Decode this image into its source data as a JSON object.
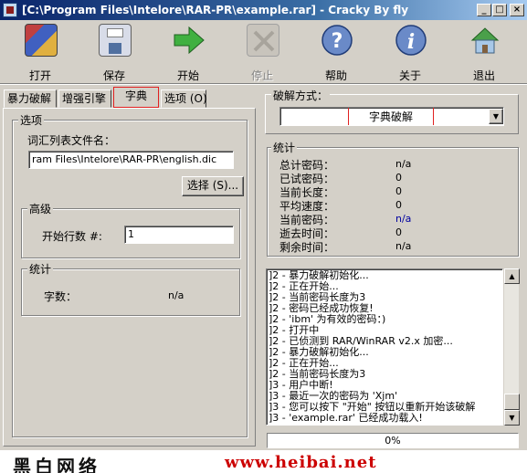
{
  "window": {
    "title": "[C:\\Program Files\\Intelore\\RAR-PR\\example.rar] - Cracky By fly",
    "min": "_",
    "max": "□",
    "close": "×"
  },
  "toolbar": {
    "open": "打开",
    "save": "保存",
    "start": "开始",
    "stop": "停止",
    "help": "帮助",
    "about": "关于",
    "exit": "退出"
  },
  "tabs": [
    "暴力破解",
    "增强引擎",
    "字典",
    "选项 (O)"
  ],
  "options": {
    "group_label": "选项",
    "wordlist_label": "词汇列表文件名：",
    "wordlist_value": "ram Files\\Intelore\\RAR-PR\\english.dic",
    "select_button": "选择 (S)...",
    "advanced_label": "高级",
    "start_line_label": "开始行数 #:",
    "start_line_value": "1",
    "stats_label": "统计",
    "word_count_label": "字数：",
    "word_count_value": "n/a"
  },
  "crack_method": {
    "label": "破解方式：",
    "selected": "字典破解"
  },
  "stats": {
    "label": "统计",
    "rows": [
      {
        "label": "总计密码：",
        "value": "n/a"
      },
      {
        "label": "已试密码：",
        "value": "0"
      },
      {
        "label": "当前长度：",
        "value": "0"
      },
      {
        "label": "平均速度：",
        "value": "0"
      },
      {
        "label": "当前密码：",
        "value": "n/a"
      },
      {
        "label": "逝去时间：",
        "value": "0"
      },
      {
        "label": "剩余时间：",
        "value": "n/a"
      }
    ]
  },
  "log": [
    "]2 - 暴力破解初始化...",
    "]2 - 正在开始...",
    "]2 - 当前密码长度为3",
    "]2 - 密码已经成功恢复!",
    "]2 - 'ibm' 为有效的密码：)",
    "]2 - 打开中",
    "]2 - 已侦测到 RAR/WinRAR v2.x 加密...",
    "]2 - 暴力破解初始化...",
    "]2 - 正在开始...",
    "]2 - 当前密码长度为3",
    "]3 - 用户中断!",
    "]3 - 最近一次的密码为 'Xjm'",
    "]3 - 您可以按下 \"开始\" 按钮以重新开始该破解",
    "]3 - 'example.rar' 已经成功载入!"
  ],
  "progress": {
    "text": "0%",
    "value": 0
  },
  "footer": {
    "left": "黑白网络",
    "right": "www.heibai.net"
  },
  "colors": {
    "window_bg": "#d4d0c8",
    "title_start": "#0a246a",
    "title_end": "#a6caf0",
    "highlight": "#e02020",
    "value_blue": "#0000a0",
    "watermark_url": "#cc0000"
  }
}
